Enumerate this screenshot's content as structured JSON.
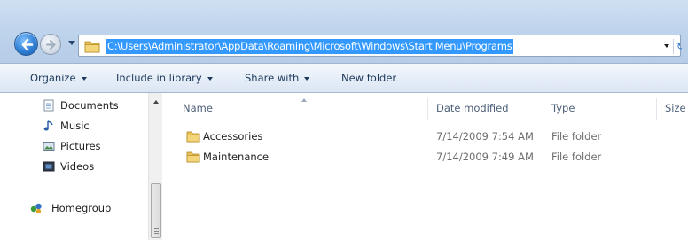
{
  "address": {
    "path": "C:\\Users\\Administrator\\AppData\\Roaming\\Microsoft\\Windows\\Start Menu\\Programs"
  },
  "toolbar": {
    "organize": "Organize",
    "include_in_library": "Include in library",
    "share_with": "Share with",
    "new_folder": "New folder"
  },
  "sidebar": {
    "items": [
      {
        "label": "Documents",
        "icon": "documents-icon"
      },
      {
        "label": "Music",
        "icon": "music-icon"
      },
      {
        "label": "Pictures",
        "icon": "pictures-icon"
      },
      {
        "label": "Videos",
        "icon": "videos-icon"
      },
      {
        "label": "Homegroup",
        "icon": "homegroup-icon"
      }
    ]
  },
  "columns": {
    "name": "Name",
    "date_modified": "Date modified",
    "type": "Type",
    "size": "Size"
  },
  "files": [
    {
      "name": "Accessories",
      "date_modified": "7/14/2009 7:54 AM",
      "type": "File folder"
    },
    {
      "name": "Maintenance",
      "date_modified": "7/14/2009 7:49 AM",
      "type": "File folder"
    }
  ],
  "colors": {
    "selection": "#3399ff",
    "folder": "#e8c15a",
    "toolbar_text": "#1e395b"
  }
}
